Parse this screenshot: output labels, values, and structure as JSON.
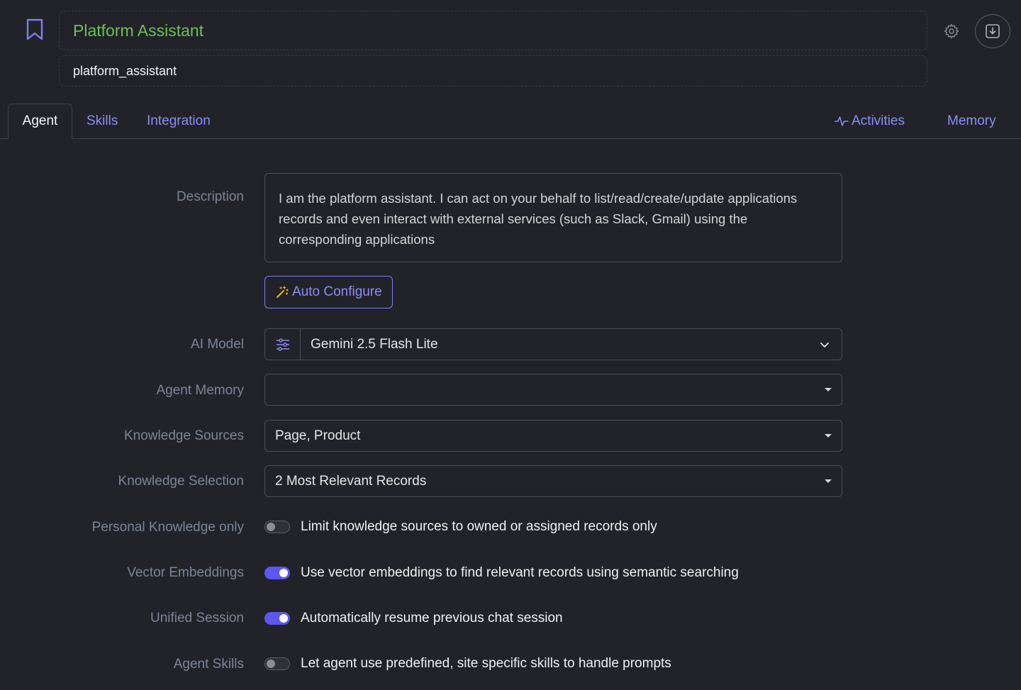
{
  "header": {
    "title": "Platform Assistant",
    "slug": "platform_assistant",
    "title_color": "#6bbf59",
    "icons": [
      "bookmark-icon",
      "gear-icon",
      "download-icon"
    ]
  },
  "tabs": {
    "agent": "Agent",
    "skills": "Skills",
    "integration": "Integration",
    "activities": "Activities",
    "memory": "Memory"
  },
  "form": {
    "description_label": "Description",
    "description_value": "I am the platform assistant. I can act on your behalf to list/read/create/update applications records and even interact with external services (such as Slack, Gmail) using the corresponding applications",
    "auto_configure_label": "Auto Configure",
    "ai_model_label": "AI Model",
    "ai_model_value": "Gemini 2.5 Flash Lite",
    "agent_memory_label": "Agent Memory",
    "agent_memory_value": "",
    "knowledge_sources_label": "Knowledge Sources",
    "knowledge_sources_value": "Page, Product",
    "knowledge_selection_label": "Knowledge Selection",
    "knowledge_selection_value": "2 Most Relevant Records",
    "personal_knowledge_label": "Personal Knowledge only",
    "personal_knowledge_text": "Limit knowledge sources to owned or assigned records only",
    "personal_knowledge_on": false,
    "vector_embeddings_label": "Vector Embeddings",
    "vector_embeddings_text": "Use vector embeddings to find relevant records using semantic searching",
    "vector_embeddings_on": true,
    "unified_session_label": "Unified Session",
    "unified_session_text": "Automatically resume previous chat session",
    "unified_session_on": true,
    "agent_skills_label": "Agent Skills",
    "agent_skills_text": "Let agent use predefined, site specific skills to handle prompts",
    "agent_skills_on": false
  },
  "colors": {
    "accent": "#8b8ef7",
    "toggle_on": "#5b57f0",
    "background": "#212328"
  }
}
